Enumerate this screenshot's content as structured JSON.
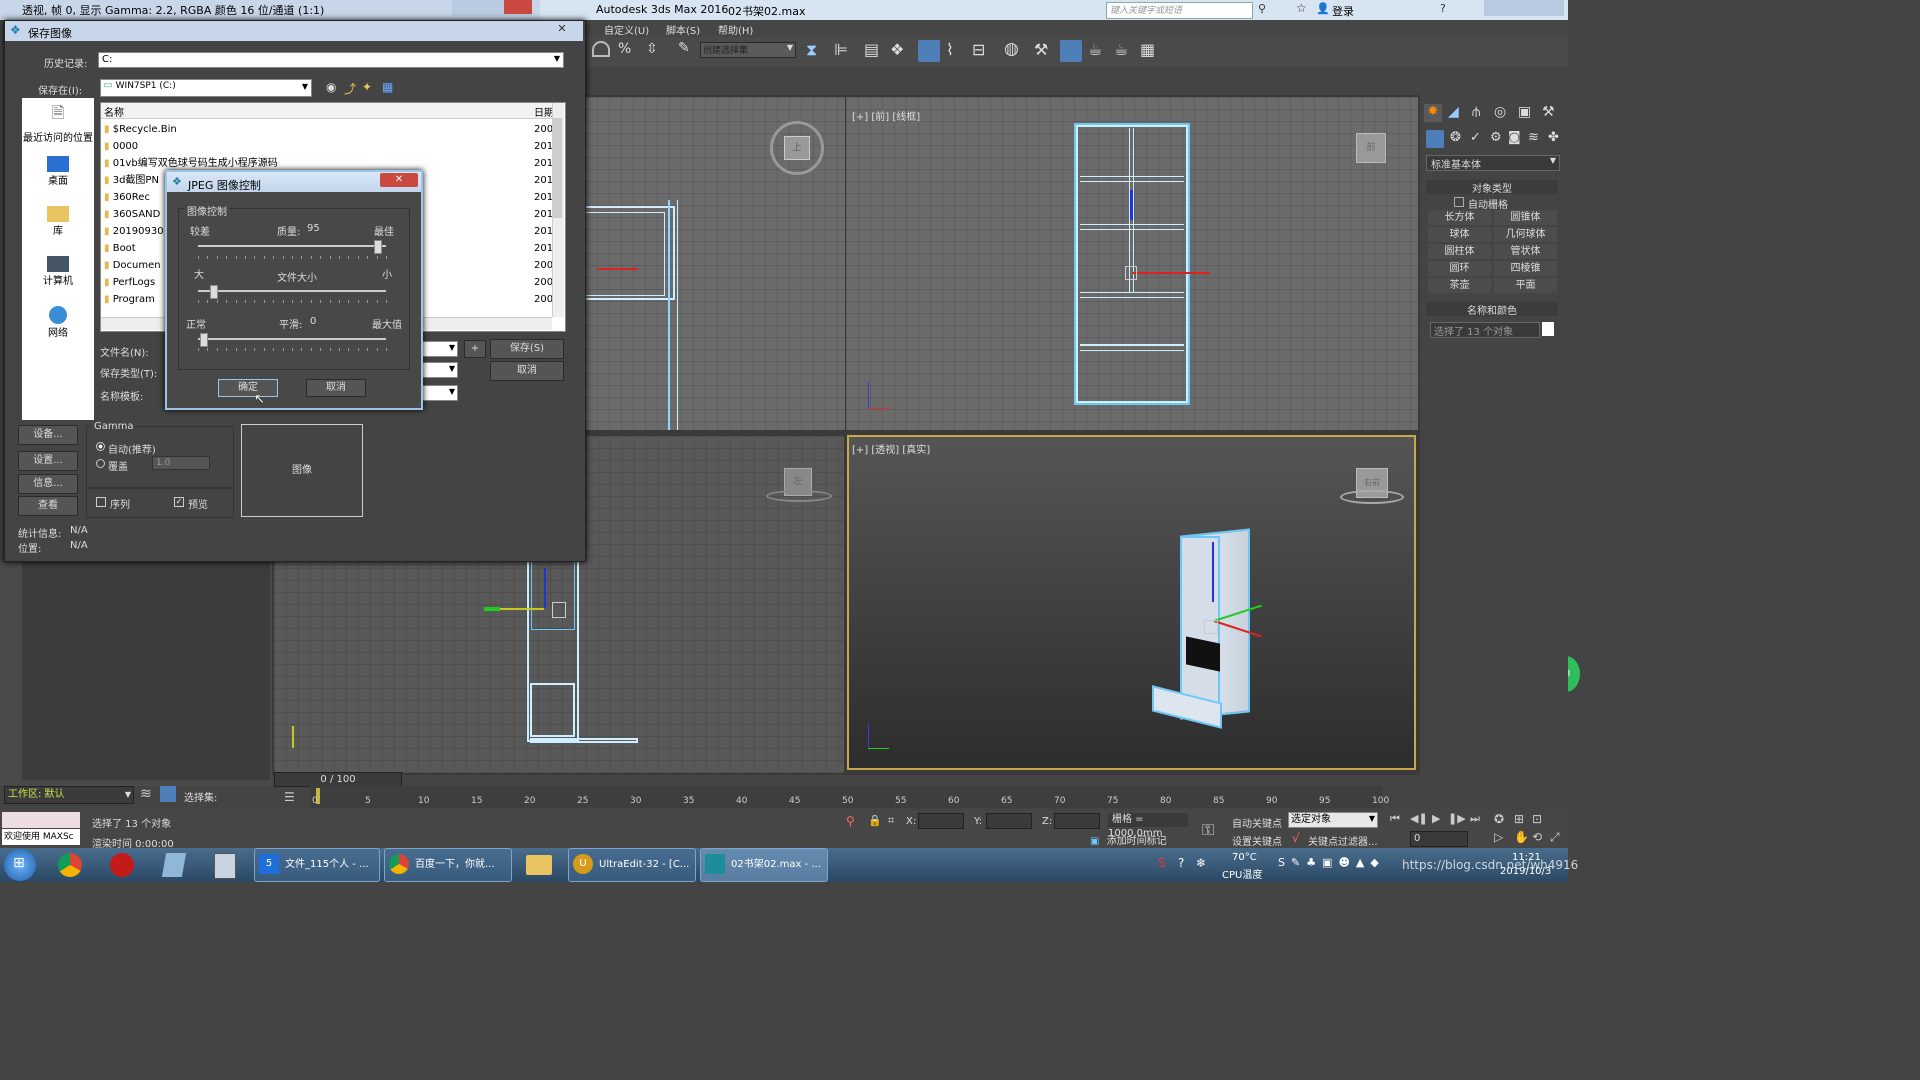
{
  "app": {
    "image_window_title": "透视, 帧 0, 显示 Gamma: 2.2, RGBA 颜色 16 位/通道 (1:1)",
    "app_name": "Autodesk 3ds Max 2016",
    "file_name": "02书架02.max",
    "search_placeholder": "键入关键字或短语",
    "login": "登录"
  },
  "menu": {
    "custom": "自定义(U)",
    "script": "脚本(S)",
    "help": "帮助(H)"
  },
  "toolbar": {
    "selection_set": "创建选择集"
  },
  "viewports": {
    "front": "[+] [前] [线框]",
    "perspective": "[+] [透视] [真实]",
    "top_cube_label": "上",
    "front_cube_label": "前",
    "left_cube_label": "左",
    "persp_cube_label": "右前"
  },
  "command_panel": {
    "category": "标准基本体",
    "object_type": "对象类型",
    "autogrid": "自动栅格",
    "buttons": [
      "长方体",
      "圆锥体",
      "球体",
      "几何球体",
      "圆柱体",
      "管状体",
      "圆环",
      "四棱锥",
      "茶壶",
      "平面"
    ],
    "name_color": "名称和颜色",
    "name_value": "选择了 13 个对象"
  },
  "save_dialog": {
    "title": "保存图像",
    "history_label": "历史记录:",
    "history_value": "C:",
    "save_in_label": "保存在(I):",
    "save_in_value": "WIN7SP1 (C:)",
    "places": [
      "最近访问的位置",
      "桌面",
      "库",
      "计算机",
      "网络"
    ],
    "col_name": "名称",
    "col_date": "日期",
    "files": [
      {
        "name": "$Recycle.Bin",
        "date": "200"
      },
      {
        "name": "0000",
        "date": "201"
      },
      {
        "name": "01vb编写双色球号码生成小程序源码",
        "date": "201"
      },
      {
        "name": "3d截图PN",
        "date": "201"
      },
      {
        "name": "360Rec",
        "date": "201"
      },
      {
        "name": "360SAND",
        "date": "201"
      },
      {
        "name": "20190930",
        "date": "201"
      },
      {
        "name": "Boot",
        "date": "201"
      },
      {
        "name": "Documen",
        "date": "200"
      },
      {
        "name": "PerfLogs",
        "date": "200"
      },
      {
        "name": "Program",
        "date": "200"
      }
    ],
    "filename_label": "文件名(N):",
    "filetype_label": "保存类型(T):",
    "template_label": "名称模板:",
    "save_btn": "保存(S)",
    "cancel_btn": "取消",
    "plus": "+",
    "settings_btn": "设备...",
    "setup_btn": "设置...",
    "info_btn": "信息...",
    "view_btn": "查看",
    "gamma_label": "Gamma",
    "gamma_auto": "自动(推荐)",
    "gamma_override": "覆盖",
    "gamma_value": "1.0",
    "sequence": "序列",
    "preview": "预览",
    "image_label": "图像",
    "stats_label": "统计信息:",
    "stats_value": "N/A",
    "location_label": "位置:",
    "location_value": "N/A"
  },
  "jpeg_dialog": {
    "title": "JPEG 图像控制",
    "group": "图像控制",
    "q_low": "较差",
    "q_label": "质量:",
    "q_value": "95",
    "q_high": "最佳",
    "size_big": "大",
    "size_label": "文件大小",
    "size_small": "小",
    "s_normal": "正常",
    "s_label": "平滑:",
    "s_value": "0",
    "s_max": "最大值",
    "ok": "确定",
    "cancel": "取消",
    "quality": 95,
    "smoothing": 0
  },
  "timeline": {
    "frame_counter": "0 / 100",
    "ticks": [
      "0",
      "5",
      "10",
      "15",
      "20",
      "25",
      "30",
      "35",
      "40",
      "45",
      "50",
      "55",
      "60",
      "65",
      "70",
      "75",
      "80",
      "85",
      "90",
      "95",
      "100"
    ]
  },
  "status": {
    "workspace": "工作区: 默认",
    "selection_set": "选择集:",
    "maxscript": "欢迎使用 MAXSc",
    "selected": "选择了 13 个对象",
    "render_time": "渲染时间 0:00:00",
    "x_label": "X:",
    "y_label": "Y:",
    "z_label": "Z:",
    "grid": "栅格 = 1000.0mm",
    "auto_key": "自动关键点",
    "set_key": "设置关键点",
    "selected_obj": "选定对象",
    "key_filter": "关键点过滤器...",
    "add_time_tag": "添加时间标记",
    "frame_value": "0"
  },
  "taskbar": {
    "items": [
      "文件_115个人 - ...",
      "百度一下，你就...",
      "UltraEdit-32 - [C...",
      "02书架02.max - ..."
    ],
    "temp": "70°C",
    "cpu": "CPU温度",
    "time": "11:21",
    "date": "2019/10/3",
    "watermark": "https://blog.csdn.net/wh4916"
  }
}
